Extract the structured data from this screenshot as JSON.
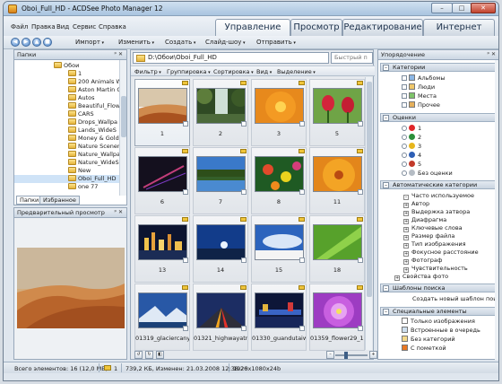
{
  "window": {
    "title": "Oboi_Full_HD - ACDSee Photo Manager 12",
    "minimize": "–",
    "maximize": "□",
    "close": "✕"
  },
  "menu": [
    "Файл",
    "Правка",
    "Вид",
    "Сервис",
    "Справка"
  ],
  "mode_tabs": [
    "Управление",
    "Просмотр",
    "Редактирование",
    "Интернет"
  ],
  "toolbar": {
    "items": [
      "Импорт",
      "Изменить",
      "Создать",
      "Слайд-шоу",
      "Отправить"
    ]
  },
  "folders_panel": {
    "title": "Папки",
    "tree": [
      "Обои",
      "1",
      "200 Animals W",
      "Aston Martin G",
      "Autos",
      "Beautiful_Flow",
      "CARS",
      "Drops_Wallpa",
      "Lands_WideS",
      "Money & Gold",
      "Nature Scener",
      "Nature_Wallpa",
      "Nature_WideS",
      "New",
      "Oboi_Full_HD",
      "one 77"
    ],
    "tabs": [
      "Папки",
      "Избранное"
    ]
  },
  "preview_panel": {
    "title": "Предварительный просмотр"
  },
  "path": {
    "value": "D:\\Обои\\Oboi_Full_HD",
    "quick_search_placeholder": "Быстрый п"
  },
  "filter_bar": [
    "Фильтр",
    "Группировка",
    "Сортировка",
    "Вид",
    "Выделение"
  ],
  "thumbnails": [
    "1",
    "2",
    "3",
    "5",
    "6",
    "7",
    "8",
    "11",
    "13",
    "14",
    "15",
    "18",
    "01319_glaciercanyo...",
    "01321_highwayatni...",
    "01330_guandutaiwa...",
    "01359_flower29_1..."
  ],
  "organize_panel": {
    "title": "Упорядочение",
    "categories_title": "Категории",
    "categories": [
      "Альбомы",
      "Люди",
      "Места",
      "Прочее"
    ],
    "ratings_title": "Оценки",
    "ratings": [
      "1",
      "2",
      "3",
      "4",
      "5",
      "Без оценки"
    ],
    "auto_title": "Автоматические категории",
    "auto_items": [
      "Часто используемое",
      "Автор",
      "Выдержка затвора",
      "Диафрагма",
      "Ключевые слова",
      "Размер файла",
      "Тип изображения",
      "Фокусное расстояние",
      "Фотограф",
      "Чувствительность",
      "Свойства фото"
    ],
    "search_title": "Шаблоны поиска",
    "search_item": "Создать новый шаблон поиска",
    "special_title": "Специальные элементы",
    "special_items": [
      "Только изображения",
      "Встроенные в очередь",
      "Без категорий",
      "С пометкой"
    ]
  },
  "status": {
    "count": "Всего элементов: 16  (12,0 МБ)",
    "selected": "1",
    "file": "739,2 КБ, Изменен: 21.03.2008 12:38:26",
    "dims": "1920x1080x24b"
  }
}
